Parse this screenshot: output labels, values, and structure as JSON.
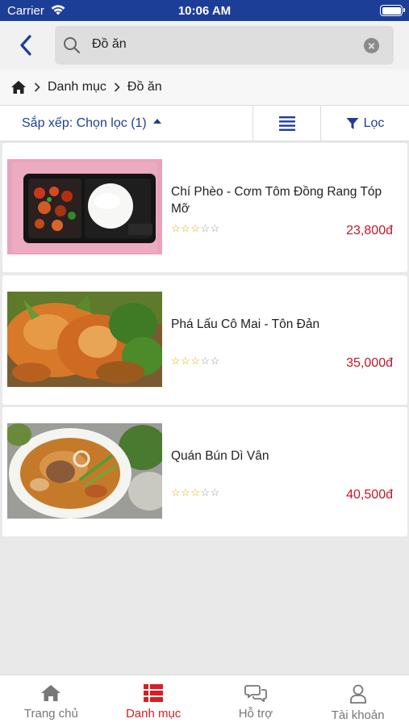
{
  "status_bar": {
    "carrier": "Carrier",
    "time": "10:06 AM"
  },
  "search": {
    "query": "Đồ ăn"
  },
  "breadcrumb": {
    "home_icon": "home-icon",
    "items": [
      "Danh mục",
      "Đồ ăn"
    ]
  },
  "sort_bar": {
    "sort_label": "Sắp xếp: Chọn lọc (1)",
    "filter_label": "Lọc"
  },
  "products": [
    {
      "name": "Chí Phèo - Cơm Tôm Đồng Rang Tóp Mỡ",
      "price": "23,800đ",
      "rating": 3,
      "image": "rice-box-with-shrimp"
    },
    {
      "name": "Phá Lấu Cô Mai - Tôn Đản",
      "price": "35,000đ",
      "rating": 3,
      "image": "braised-meat-with-herbs"
    },
    {
      "name": "Quán Bún Dì Vân",
      "price": "40,500đ",
      "rating": 3,
      "image": "noodle-soup-bowl"
    }
  ],
  "bottom_nav": [
    {
      "label": "Trang chủ",
      "icon": "home-icon",
      "active": false
    },
    {
      "label": "Danh mục",
      "icon": "category-list-icon",
      "active": true
    },
    {
      "label": "Hỗ trợ",
      "icon": "chat-bubbles-icon",
      "active": false
    },
    {
      "label": "Tài khoản",
      "icon": "user-icon",
      "active": false
    }
  ],
  "colors": {
    "brand": "#1d3e97",
    "price": "#c4162a",
    "active_tab": "#d81e22",
    "star": "#e0a800"
  }
}
